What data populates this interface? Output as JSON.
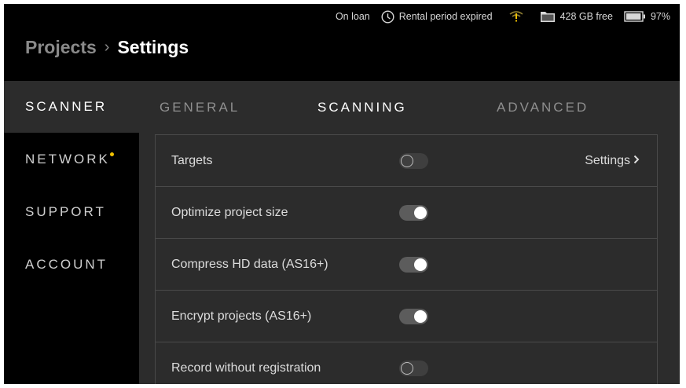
{
  "status": {
    "loan": "On loan",
    "rental": "Rental period expired",
    "storage": "428 GB free",
    "battery": "97%",
    "battery_level": 0.97,
    "icons": [
      "clock-icon",
      "wifi-warning-icon",
      "folder-icon",
      "battery-icon"
    ],
    "warning_color": "#f2c200"
  },
  "breadcrumb": {
    "parent": "Projects",
    "separator": "›",
    "current": "Settings"
  },
  "sidebar": {
    "items": [
      {
        "label": "SCANNER",
        "active": true
      },
      {
        "label": "NETWORK",
        "badge": true
      },
      {
        "label": "SUPPORT"
      },
      {
        "label": "ACCOUNT"
      }
    ]
  },
  "tabs": [
    {
      "label": "GENERAL"
    },
    {
      "label": "SCANNING",
      "active": true
    },
    {
      "label": "ADVANCED"
    }
  ],
  "settings": {
    "rows": [
      {
        "label": "Targets",
        "enabled": false,
        "link": "Settings"
      },
      {
        "label": "Optimize project size",
        "enabled": true
      },
      {
        "label": "Compress HD data (AS16+)",
        "enabled": true
      },
      {
        "label": "Encrypt projects (AS16+)",
        "enabled": true
      },
      {
        "label": "Record without registration",
        "enabled": false
      }
    ]
  }
}
